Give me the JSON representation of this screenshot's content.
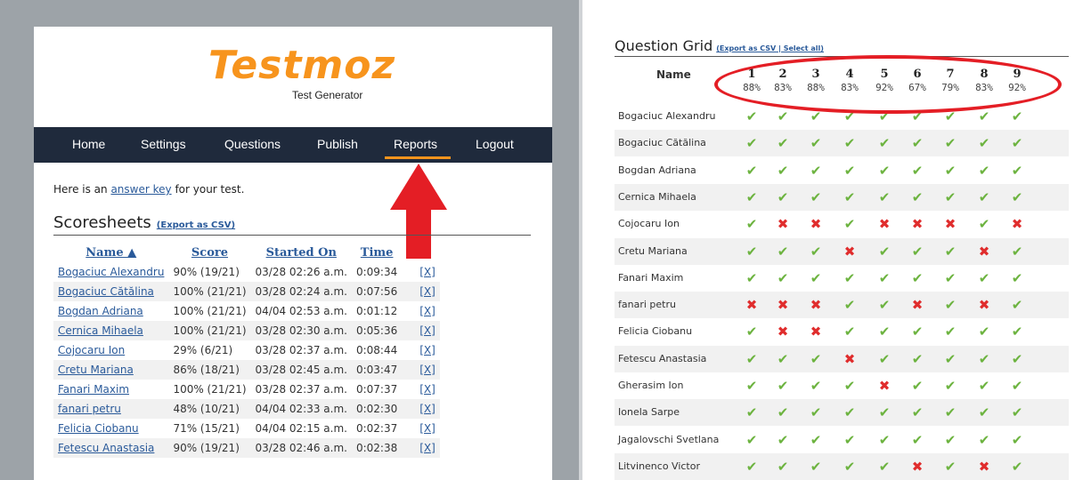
{
  "app": {
    "logo": "Testmoz",
    "tagline": "Test Generator"
  },
  "nav": {
    "items": [
      "Home",
      "Settings",
      "Questions",
      "Publish",
      "Reports",
      "Logout"
    ],
    "active": "Reports"
  },
  "intro": {
    "prefix": "Here is an ",
    "link": "answer key",
    "suffix": " for your test."
  },
  "scoresheets": {
    "title": "Scoresheets",
    "export_label": "(Export as CSV)",
    "columns": [
      "Name ▲",
      "Score",
      "Started On",
      "Time"
    ],
    "delete_label": "[X]",
    "rows": [
      {
        "name": "Bogaciuc Alexandru",
        "score": "90% (19/21)",
        "started": "03/28 02:26 a.m.",
        "time": "0:09:34"
      },
      {
        "name": "Bogaciuc Cătălina",
        "score": "100% (21/21)",
        "started": "03/28 02:24 a.m.",
        "time": "0:07:56"
      },
      {
        "name": "Bogdan Adriana",
        "score": "100% (21/21)",
        "started": "04/04 02:53 a.m.",
        "time": "0:01:12"
      },
      {
        "name": "Cernica Mihaela",
        "score": "100% (21/21)",
        "started": "03/28 02:30 a.m.",
        "time": "0:05:36"
      },
      {
        "name": "Cojocaru Ion",
        "score": "29% (6/21)",
        "started": "03/28 02:37 a.m.",
        "time": "0:08:44"
      },
      {
        "name": "Cretu Mariana",
        "score": "86% (18/21)",
        "started": "03/28 02:45 a.m.",
        "time": "0:03:47"
      },
      {
        "name": "Fanari Maxim",
        "score": "100% (21/21)",
        "started": "03/28 02:37 a.m.",
        "time": "0:07:37"
      },
      {
        "name": "fanari petru",
        "score": "48% (10/21)",
        "started": "04/04 02:33 a.m.",
        "time": "0:02:30"
      },
      {
        "name": "Felicia Ciobanu",
        "score": "71% (15/21)",
        "started": "04/04 02:15 a.m.",
        "time": "0:02:37"
      },
      {
        "name": "Fetescu Anastasia",
        "score": "90% (19/21)",
        "started": "03/28 02:46 a.m.",
        "time": "0:02:38"
      }
    ]
  },
  "question_grid": {
    "title": "Question Grid",
    "links": "(Export as CSV | Select all)",
    "name_header": "Name",
    "questions": [
      {
        "num": "1",
        "pct": "88%"
      },
      {
        "num": "2",
        "pct": "83%"
      },
      {
        "num": "3",
        "pct": "88%"
      },
      {
        "num": "4",
        "pct": "83%"
      },
      {
        "num": "5",
        "pct": "92%"
      },
      {
        "num": "6",
        "pct": "67%"
      },
      {
        "num": "7",
        "pct": "79%"
      },
      {
        "num": "8",
        "pct": "83%"
      },
      {
        "num": "9",
        "pct": "92%"
      }
    ],
    "correct_icon": "✔",
    "wrong_icon": "✖",
    "rows": [
      {
        "name": "Bogaciuc Alexandru",
        "marks": [
          1,
          1,
          1,
          1,
          1,
          1,
          1,
          1,
          1
        ]
      },
      {
        "name": "Bogaciuc Cătălina",
        "marks": [
          1,
          1,
          1,
          1,
          1,
          1,
          1,
          1,
          1
        ]
      },
      {
        "name": "Bogdan Adriana",
        "marks": [
          1,
          1,
          1,
          1,
          1,
          1,
          1,
          1,
          1
        ]
      },
      {
        "name": "Cernica Mihaela",
        "marks": [
          1,
          1,
          1,
          1,
          1,
          1,
          1,
          1,
          1
        ]
      },
      {
        "name": "Cojocaru Ion",
        "marks": [
          1,
          0,
          0,
          1,
          0,
          0,
          0,
          1,
          0
        ]
      },
      {
        "name": "Cretu Mariana",
        "marks": [
          1,
          1,
          1,
          0,
          1,
          1,
          1,
          0,
          1
        ]
      },
      {
        "name": "Fanari Maxim",
        "marks": [
          1,
          1,
          1,
          1,
          1,
          1,
          1,
          1,
          1
        ]
      },
      {
        "name": "fanari petru",
        "marks": [
          0,
          0,
          0,
          1,
          1,
          0,
          1,
          0,
          1
        ]
      },
      {
        "name": "Felicia Ciobanu",
        "marks": [
          1,
          0,
          0,
          1,
          1,
          1,
          1,
          1,
          1
        ]
      },
      {
        "name": "Fetescu Anastasia",
        "marks": [
          1,
          1,
          1,
          0,
          1,
          1,
          1,
          1,
          1
        ]
      },
      {
        "name": "Gherasim Ion",
        "marks": [
          1,
          1,
          1,
          1,
          0,
          1,
          1,
          1,
          1
        ]
      },
      {
        "name": "Ionela Sarpe",
        "marks": [
          1,
          1,
          1,
          1,
          1,
          1,
          1,
          1,
          1
        ]
      },
      {
        "name": "Jagalovschi Svetlana",
        "marks": [
          1,
          1,
          1,
          1,
          1,
          1,
          1,
          1,
          1
        ]
      },
      {
        "name": "Litvinenco Victor",
        "marks": [
          1,
          1,
          1,
          1,
          1,
          0,
          1,
          0,
          1
        ]
      }
    ]
  },
  "colors": {
    "accent": "#f7941d",
    "nav_bg": "#1f2a3c",
    "highlight_red": "#e41e25",
    "correct": "#6cb33f",
    "wrong": "#e02d2d"
  }
}
